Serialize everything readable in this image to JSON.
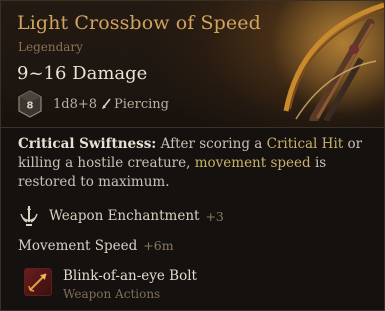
{
  "item": {
    "name": "Light Crossbow of Speed",
    "rarity": "Legendary",
    "damage": "9~16 Damage",
    "dice_icon_value": "8",
    "dice_formula": "1d8+8",
    "damage_type": "Piercing"
  },
  "passive": {
    "name": "Critical Swiftness:",
    "text_1": " After scoring a ",
    "highlight_1": "Critical Hit",
    "text_2": " or killing a hostile creature, ",
    "highlight_2": "movement speed",
    "text_3": " is restored to maximum."
  },
  "properties": {
    "enchantment_label": "Weapon Enchantment",
    "enchantment_value": "+3",
    "movement_label": "Movement Speed",
    "movement_value": "+6m"
  },
  "action": {
    "name": "Blink-of-an-eye Bolt",
    "category": "Weapon Actions"
  },
  "colors": {
    "title": "#d2a35d",
    "rarity": "#8d7350",
    "highlight": "#c9b26a",
    "background": "#15110e"
  },
  "icons": {
    "dice": "d8-dice-icon",
    "damage_type": "piercing-arrow-icon",
    "enchantment": "sword-enchant-icon",
    "action": "blink-bolt-icon",
    "art": "crossbow-art"
  }
}
